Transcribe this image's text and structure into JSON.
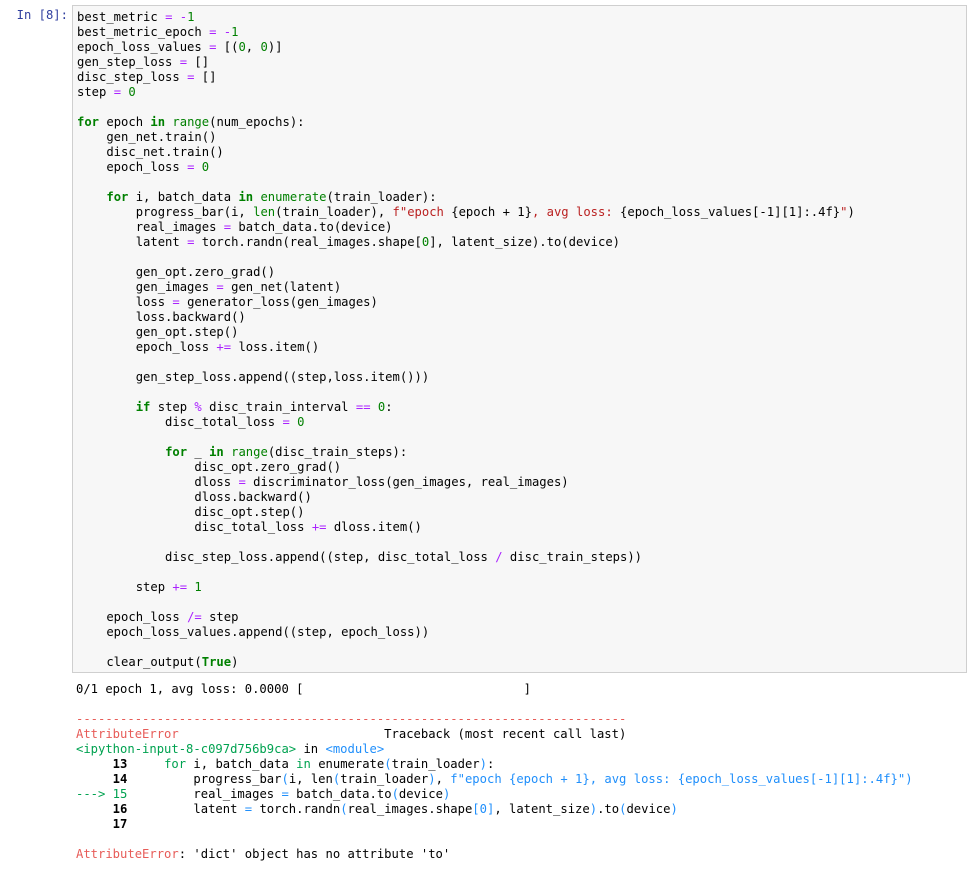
{
  "cell": {
    "prompt": "In [8]:",
    "code_lines": [
      [
        {
          "t": "best_metric "
        },
        {
          "t": "=",
          "c": "o"
        },
        {
          "t": " "
        },
        {
          "t": "-",
          "c": "o"
        },
        {
          "t": "1",
          "c": "n"
        }
      ],
      [
        {
          "t": "best_metric_epoch "
        },
        {
          "t": "=",
          "c": "o"
        },
        {
          "t": " "
        },
        {
          "t": "-",
          "c": "o"
        },
        {
          "t": "1",
          "c": "n"
        }
      ],
      [
        {
          "t": "epoch_loss_values "
        },
        {
          "t": "=",
          "c": "o"
        },
        {
          "t": " [("
        },
        {
          "t": "0",
          "c": "n"
        },
        {
          "t": ", "
        },
        {
          "t": "0",
          "c": "n"
        },
        {
          "t": ")]"
        }
      ],
      [
        {
          "t": "gen_step_loss "
        },
        {
          "t": "=",
          "c": "o"
        },
        {
          "t": " []"
        }
      ],
      [
        {
          "t": "disc_step_loss "
        },
        {
          "t": "=",
          "c": "o"
        },
        {
          "t": " []"
        }
      ],
      [
        {
          "t": "step "
        },
        {
          "t": "=",
          "c": "o"
        },
        {
          "t": " "
        },
        {
          "t": "0",
          "c": "n"
        }
      ],
      [],
      [
        {
          "t": "for",
          "c": "k"
        },
        {
          "t": " epoch "
        },
        {
          "t": "in",
          "c": "k"
        },
        {
          "t": " "
        },
        {
          "t": "range",
          "c": "bi"
        },
        {
          "t": "(num_epochs):"
        }
      ],
      [
        {
          "t": "    gen_net"
        },
        {
          "t": "."
        },
        {
          "t": "train()"
        }
      ],
      [
        {
          "t": "    disc_net"
        },
        {
          "t": "."
        },
        {
          "t": "train()"
        }
      ],
      [
        {
          "t": "    epoch_loss "
        },
        {
          "t": "=",
          "c": "o"
        },
        {
          "t": " "
        },
        {
          "t": "0",
          "c": "n"
        }
      ],
      [],
      [
        {
          "t": "    "
        },
        {
          "t": "for",
          "c": "k"
        },
        {
          "t": " i, batch_data "
        },
        {
          "t": "in",
          "c": "k"
        },
        {
          "t": " "
        },
        {
          "t": "enumerate",
          "c": "bi"
        },
        {
          "t": "(train_loader):"
        }
      ],
      [
        {
          "t": "        progress_bar(i, "
        },
        {
          "t": "len",
          "c": "bi"
        },
        {
          "t": "(train_loader), "
        },
        {
          "t": "f\"epoch ",
          "c": "s"
        },
        {
          "t": "{epoch + 1}"
        },
        {
          "t": ", avg loss: ",
          "c": "s"
        },
        {
          "t": "{epoch_loss_values[-1][1]:.4f}"
        },
        {
          "t": "\"",
          "c": "s"
        },
        {
          "t": ")"
        }
      ],
      [
        {
          "t": "        real_images "
        },
        {
          "t": "=",
          "c": "o"
        },
        {
          "t": " batch_data.to(device)"
        }
      ],
      [
        {
          "t": "        latent "
        },
        {
          "t": "=",
          "c": "o"
        },
        {
          "t": " torch.randn(real_images.shape["
        },
        {
          "t": "0",
          "c": "n"
        },
        {
          "t": "], latent_size).to(device)"
        }
      ],
      [],
      [
        {
          "t": "        gen_opt.zero_grad()"
        }
      ],
      [
        {
          "t": "        gen_images "
        },
        {
          "t": "=",
          "c": "o"
        },
        {
          "t": " gen_net(latent)"
        }
      ],
      [
        {
          "t": "        loss "
        },
        {
          "t": "=",
          "c": "o"
        },
        {
          "t": " generator_loss(gen_images)"
        }
      ],
      [
        {
          "t": "        loss.backward()"
        }
      ],
      [
        {
          "t": "        gen_opt.step()"
        }
      ],
      [
        {
          "t": "        epoch_loss "
        },
        {
          "t": "+=",
          "c": "o"
        },
        {
          "t": " loss.item()"
        }
      ],
      [],
      [
        {
          "t": "        gen_step_loss.append((step,loss.item()))"
        }
      ],
      [],
      [
        {
          "t": "        "
        },
        {
          "t": "if",
          "c": "k"
        },
        {
          "t": " step "
        },
        {
          "t": "%",
          "c": "o"
        },
        {
          "t": " disc_train_interval "
        },
        {
          "t": "==",
          "c": "o"
        },
        {
          "t": " "
        },
        {
          "t": "0",
          "c": "n"
        },
        {
          "t": ":"
        }
      ],
      [
        {
          "t": "            disc_total_loss "
        },
        {
          "t": "=",
          "c": "o"
        },
        {
          "t": " "
        },
        {
          "t": "0",
          "c": "n"
        }
      ],
      [],
      [
        {
          "t": "            "
        },
        {
          "t": "for",
          "c": "k"
        },
        {
          "t": " _ "
        },
        {
          "t": "in",
          "c": "k"
        },
        {
          "t": " "
        },
        {
          "t": "range",
          "c": "bi"
        },
        {
          "t": "(disc_train_steps):"
        }
      ],
      [
        {
          "t": "                disc_opt.zero_grad()"
        }
      ],
      [
        {
          "t": "                dloss "
        },
        {
          "t": "=",
          "c": "o"
        },
        {
          "t": " discriminator_loss(gen_images, real_images)"
        }
      ],
      [
        {
          "t": "                dloss.backward()"
        }
      ],
      [
        {
          "t": "                disc_opt.step()"
        }
      ],
      [
        {
          "t": "                disc_total_loss "
        },
        {
          "t": "+=",
          "c": "o"
        },
        {
          "t": " dloss.item()"
        }
      ],
      [],
      [
        {
          "t": "            disc_step_loss.append((step, disc_total_loss "
        },
        {
          "t": "/",
          "c": "o"
        },
        {
          "t": " disc_train_steps))"
        }
      ],
      [],
      [
        {
          "t": "        step "
        },
        {
          "t": "+=",
          "c": "o"
        },
        {
          "t": " "
        },
        {
          "t": "1",
          "c": "n"
        }
      ],
      [],
      [
        {
          "t": "    epoch_loss "
        },
        {
          "t": "/=",
          "c": "o"
        },
        {
          "t": " step"
        }
      ],
      [
        {
          "t": "    epoch_loss_values.append((step, epoch_loss))"
        }
      ],
      [],
      [
        {
          "t": "    clear_output("
        },
        {
          "t": "True",
          "c": "k"
        },
        {
          "t": ")"
        }
      ]
    ]
  },
  "output": {
    "progress_line": "0/1 epoch 1, avg loss: 0.0000 [                              ]",
    "traceback_lines": [
      [],
      [
        {
          "t": "---------------------------------------------------------------------------",
          "c": "err"
        }
      ],
      [
        {
          "t": "AttributeError",
          "c": "err"
        },
        {
          "t": "                            Traceback (most recent call last)"
        }
      ],
      [
        {
          "t": "<ipython-input-8-c097d756b9ca>",
          "c": "eg"
        },
        {
          "t": " in "
        },
        {
          "t": "<module>",
          "c": "ec"
        }
      ],
      [
        {
          "t": "     13",
          "c": "ln"
        },
        {
          "t": "     "
        },
        {
          "t": "for",
          "c": "eg"
        },
        {
          "t": " i"
        },
        {
          "t": ","
        },
        {
          "t": " batch_data "
        },
        {
          "t": "in",
          "c": "eg"
        },
        {
          "t": " enumerate"
        },
        {
          "t": "(",
          "c": "ec"
        },
        {
          "t": "train_loader"
        },
        {
          "t": ")",
          "c": "ec"
        },
        {
          "t": ":"
        }
      ],
      [
        {
          "t": "     14",
          "c": "ln"
        },
        {
          "t": "         progress_bar"
        },
        {
          "t": "(",
          "c": "ec"
        },
        {
          "t": "i"
        },
        {
          "t": ", "
        },
        {
          "t": "len"
        },
        {
          "t": "(",
          "c": "ec"
        },
        {
          "t": "train_loader"
        },
        {
          "t": ")",
          "c": "ec"
        },
        {
          "t": ", "
        },
        {
          "t": "f\"epoch {epoch + 1}, avg loss: {epoch_loss_values[-1][1]:.4f}\"",
          "c": "ec"
        },
        {
          "t": ")",
          "c": "ec"
        }
      ],
      [
        {
          "t": "---> 15",
          "c": "eg"
        },
        {
          "t": "         real_images "
        },
        {
          "t": "=",
          "c": "ec"
        },
        {
          "t": " batch_data"
        },
        {
          "t": "."
        },
        {
          "t": "to"
        },
        {
          "t": "(",
          "c": "ec"
        },
        {
          "t": "device"
        },
        {
          "t": ")",
          "c": "ec"
        }
      ],
      [
        {
          "t": "     16",
          "c": "ln"
        },
        {
          "t": "         latent "
        },
        {
          "t": "=",
          "c": "ec"
        },
        {
          "t": " torch"
        },
        {
          "t": "."
        },
        {
          "t": "randn"
        },
        {
          "t": "(",
          "c": "ec"
        },
        {
          "t": "real_images"
        },
        {
          "t": "."
        },
        {
          "t": "shape"
        },
        {
          "t": "[",
          "c": "ec"
        },
        {
          "t": "0",
          "c": "ec"
        },
        {
          "t": "]",
          "c": "ec"
        },
        {
          "t": ", "
        },
        {
          "t": "latent_size"
        },
        {
          "t": ")",
          "c": "ec"
        },
        {
          "t": "."
        },
        {
          "t": "to"
        },
        {
          "t": "(",
          "c": "ec"
        },
        {
          "t": "device"
        },
        {
          "t": ")",
          "c": "ec"
        }
      ],
      [
        {
          "t": "     17",
          "c": "ln"
        }
      ],
      [],
      [
        {
          "t": "AttributeError",
          "c": "err"
        },
        {
          "t": ": 'dict' object has no attribute 'to'"
        }
      ]
    ]
  }
}
